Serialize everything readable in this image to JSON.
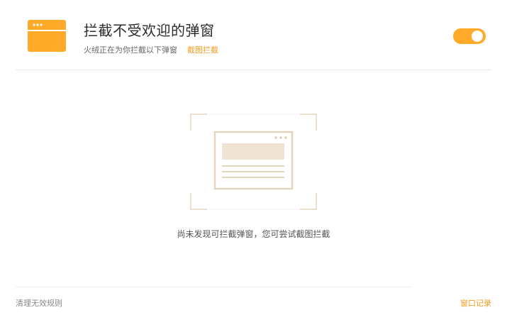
{
  "header": {
    "icon": "browser-window-icon",
    "title": "拦截不受欢迎的弹窗",
    "subtitle": "火绒正在为你拦截以下弹窗",
    "screenshot_link": "截图拦截"
  },
  "toggle": {
    "state": "on",
    "color": "#ffa929"
  },
  "empty_state": {
    "illustration": "popup-window-illustration",
    "message": "尚未发现可拦截弹窗，您可尝试截图拦截"
  },
  "footer": {
    "clear_rules": "清理无效规则",
    "history": "窗口记录"
  },
  "colors": {
    "accent": "#ffa929",
    "link": "#f39a1e",
    "illustration_line": "#e3d4bd"
  }
}
